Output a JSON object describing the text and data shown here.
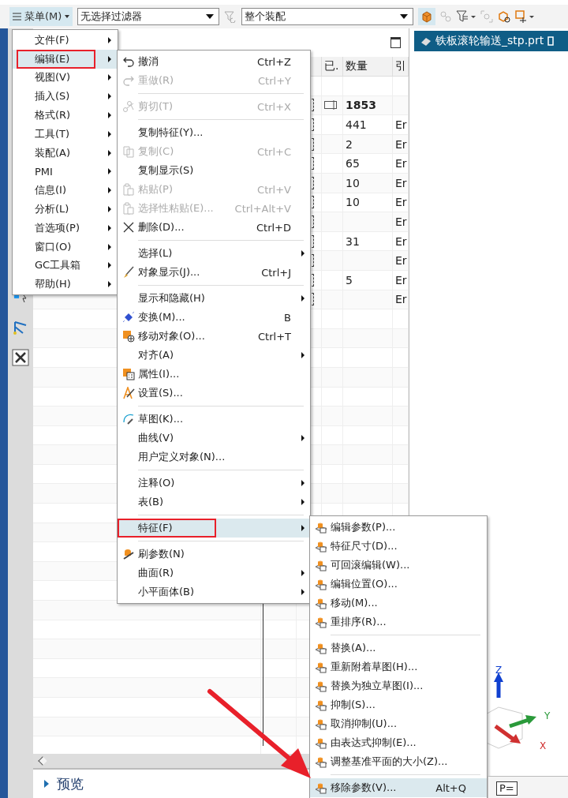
{
  "toolbar": {
    "menu_button": {
      "label": "菜单(M)",
      "selected": true
    },
    "selection_filter": {
      "value": "无选择过滤器"
    },
    "scope": {
      "value": "整个装配"
    }
  },
  "navigator": {
    "columns": [
      {
        "label": "已."
      },
      {
        "label": "数量"
      },
      {
        "label": "引"
      }
    ],
    "rows": [
      {
        "edit_icon": false,
        "part_icon": false
      },
      {
        "quantity": "1853",
        "edit_icon": true,
        "part_icon": true
      },
      {
        "quantity": "441",
        "ref": "Er",
        "edit_icon": false,
        "part_icon": true
      },
      {
        "quantity": "2",
        "ref": "Er",
        "edit_icon": false,
        "part_icon": true
      },
      {
        "quantity": "65",
        "ref": "Er",
        "edit_icon": false,
        "part_icon": true
      },
      {
        "quantity": "10",
        "ref": "Er",
        "edit_icon": false,
        "part_icon": true
      },
      {
        "quantity": "10",
        "ref": "Er",
        "edit_icon": false,
        "part_icon": true
      },
      {
        "ref": "Er",
        "edit_icon": false,
        "part_icon": true
      },
      {
        "quantity": "31",
        "ref": "Er",
        "edit_icon": false,
        "part_icon": true
      },
      {
        "ref": "Er",
        "edit_icon": false,
        "part_icon": true
      },
      {
        "quantity": "5",
        "ref": "Er",
        "edit_icon": false,
        "part_icon": true
      },
      {
        "ref": "Er",
        "edit_icon": false,
        "part_icon": true
      }
    ],
    "preview_section": {
      "label": "预览",
      "expanded": false
    }
  },
  "graphics_tab": {
    "title": "铁板滚轮输送_stp.prt"
  },
  "triad": {
    "x": "X",
    "y": "Y",
    "z": "Z"
  },
  "main_menu": [
    {
      "label": "文件(F)",
      "selected": false,
      "annotated": false
    },
    {
      "label": "编辑(E)",
      "selected": true,
      "annotated": true
    },
    {
      "label": "视图(V)",
      "selected": false,
      "annotated": false
    },
    {
      "label": "插入(S)",
      "selected": false,
      "annotated": false
    },
    {
      "label": "格式(R)",
      "selected": false,
      "annotated": false
    },
    {
      "label": "工具(T)",
      "selected": false,
      "annotated": false
    },
    {
      "label": "装配(A)",
      "selected": false,
      "annotated": false
    },
    {
      "label": "PMI",
      "selected": false,
      "annotated": false
    },
    {
      "label": "信息(I)",
      "selected": false,
      "annotated": false
    },
    {
      "label": "分析(L)",
      "selected": false,
      "annotated": false
    },
    {
      "label": "首选项(P)",
      "selected": false,
      "annotated": false
    },
    {
      "label": "窗口(O)",
      "selected": false,
      "annotated": false
    },
    {
      "label": "GC工具箱",
      "selected": false,
      "annotated": false
    },
    {
      "label": "帮助(H)",
      "selected": false,
      "annotated": false
    }
  ],
  "edit_menu": [
    {
      "kind": "item",
      "label": "撤消",
      "shortcut": "Ctrl+Z",
      "disabled": false,
      "submenu": false,
      "selected": false,
      "annotated": false
    },
    {
      "kind": "item",
      "label": "重做(R)",
      "shortcut": "Ctrl+Y",
      "disabled": true,
      "submenu": false,
      "selected": false,
      "annotated": false
    },
    {
      "kind": "separator"
    },
    {
      "kind": "item",
      "label": "剪切(T)",
      "shortcut": "Ctrl+X",
      "disabled": true,
      "submenu": false,
      "selected": false,
      "annotated": false
    },
    {
      "kind": "separator"
    },
    {
      "kind": "item",
      "label": "复制特征(Y)...",
      "disabled": false,
      "submenu": false,
      "selected": false,
      "annotated": false
    },
    {
      "kind": "item",
      "label": "复制(C)",
      "shortcut": "Ctrl+C",
      "disabled": true,
      "submenu": false,
      "selected": false,
      "annotated": false
    },
    {
      "kind": "item",
      "label": "复制显示(S)",
      "disabled": false,
      "submenu": false,
      "selected": false,
      "annotated": false
    },
    {
      "kind": "item",
      "label": "粘贴(P)",
      "shortcut": "Ctrl+V",
      "disabled": true,
      "submenu": false,
      "selected": false,
      "annotated": false
    },
    {
      "kind": "item",
      "label": "选择性粘贴(E)...",
      "shortcut": "Ctrl+Alt+V",
      "disabled": true,
      "submenu": false,
      "selected": false,
      "annotated": false
    },
    {
      "kind": "item",
      "label": "删除(D)...",
      "shortcut": "Ctrl+D",
      "disabled": false,
      "submenu": false,
      "selected": false,
      "annotated": false
    },
    {
      "kind": "separator"
    },
    {
      "kind": "item",
      "label": "选择(L)",
      "disabled": false,
      "submenu": true,
      "selected": false,
      "annotated": false
    },
    {
      "kind": "item",
      "label": "对象显示(J)...",
      "shortcut": "Ctrl+J",
      "disabled": false,
      "submenu": false,
      "selected": false,
      "annotated": false
    },
    {
      "kind": "separator"
    },
    {
      "kind": "item",
      "label": "显示和隐藏(H)",
      "disabled": false,
      "submenu": true,
      "selected": false,
      "annotated": false
    },
    {
      "kind": "item",
      "label": "变换(M)...",
      "shortcut": "B",
      "disabled": false,
      "submenu": false,
      "selected": false,
      "annotated": false
    },
    {
      "kind": "item",
      "label": "移动对象(O)...",
      "shortcut": "Ctrl+T",
      "disabled": false,
      "submenu": false,
      "selected": false,
      "annotated": false
    },
    {
      "kind": "item",
      "label": "对齐(A)",
      "disabled": false,
      "submenu": true,
      "selected": false,
      "annotated": false
    },
    {
      "kind": "item",
      "label": "属性(I)...",
      "disabled": false,
      "submenu": false,
      "selected": false,
      "annotated": false
    },
    {
      "kind": "item",
      "label": "设置(S)...",
      "disabled": false,
      "submenu": false,
      "selected": false,
      "annotated": false
    },
    {
      "kind": "separator"
    },
    {
      "kind": "item",
      "label": "草图(K)...",
      "disabled": false,
      "submenu": false,
      "selected": false,
      "annotated": false
    },
    {
      "kind": "item",
      "label": "曲线(V)",
      "disabled": false,
      "submenu": true,
      "selected": false,
      "annotated": false
    },
    {
      "kind": "item",
      "label": "用户定义对象(N)...",
      "disabled": false,
      "submenu": false,
      "selected": false,
      "annotated": false
    },
    {
      "kind": "separator"
    },
    {
      "kind": "item",
      "label": "注释(O)",
      "disabled": false,
      "submenu": true,
      "selected": false,
      "annotated": false
    },
    {
      "kind": "item",
      "label": "表(B)",
      "disabled": false,
      "submenu": true,
      "selected": false,
      "annotated": false
    },
    {
      "kind": "separator"
    },
    {
      "kind": "item",
      "label": "特征(F)",
      "disabled": false,
      "submenu": true,
      "selected": true,
      "annotated": true
    },
    {
      "kind": "separator"
    },
    {
      "kind": "item",
      "label": "刷参数(N)",
      "disabled": false,
      "submenu": false,
      "selected": false,
      "annotated": false
    },
    {
      "kind": "item",
      "label": "曲面(R)",
      "disabled": false,
      "submenu": true,
      "selected": false,
      "annotated": false
    },
    {
      "kind": "item",
      "label": "小平面体(B)",
      "disabled": false,
      "submenu": true,
      "selected": false,
      "annotated": false
    }
  ],
  "feature_menu": [
    {
      "kind": "item",
      "label": "编辑参数(P)...",
      "selected": false
    },
    {
      "kind": "item",
      "label": "特征尺寸(D)...",
      "selected": false
    },
    {
      "kind": "item",
      "label": "可回滚编辑(W)...",
      "selected": false
    },
    {
      "kind": "item",
      "label": "编辑位置(O)...",
      "selected": false
    },
    {
      "kind": "item",
      "label": "移动(M)...",
      "selected": false
    },
    {
      "kind": "item",
      "label": "重排序(R)...",
      "selected": false
    },
    {
      "kind": "separator"
    },
    {
      "kind": "item",
      "label": "替换(A)...",
      "selected": false
    },
    {
      "kind": "item",
      "label": "重新附着草图(H)...",
      "selected": false
    },
    {
      "kind": "item",
      "label": "替换为独立草图(I)...",
      "selected": false
    },
    {
      "kind": "item",
      "label": "抑制(S)...",
      "selected": false
    },
    {
      "kind": "item",
      "label": "取消抑制(U)...",
      "selected": false
    },
    {
      "kind": "item",
      "label": "由表达式抑制(E)...",
      "selected": false
    },
    {
      "kind": "item",
      "label": "调整基准平面的大小(Z)...",
      "selected": false
    },
    {
      "kind": "separator"
    },
    {
      "kind": "item",
      "label": "移除参数(V)...",
      "shortcut": "Alt+Q",
      "selected": true
    }
  ],
  "tooltip": {
    "icon_text": "P="
  }
}
